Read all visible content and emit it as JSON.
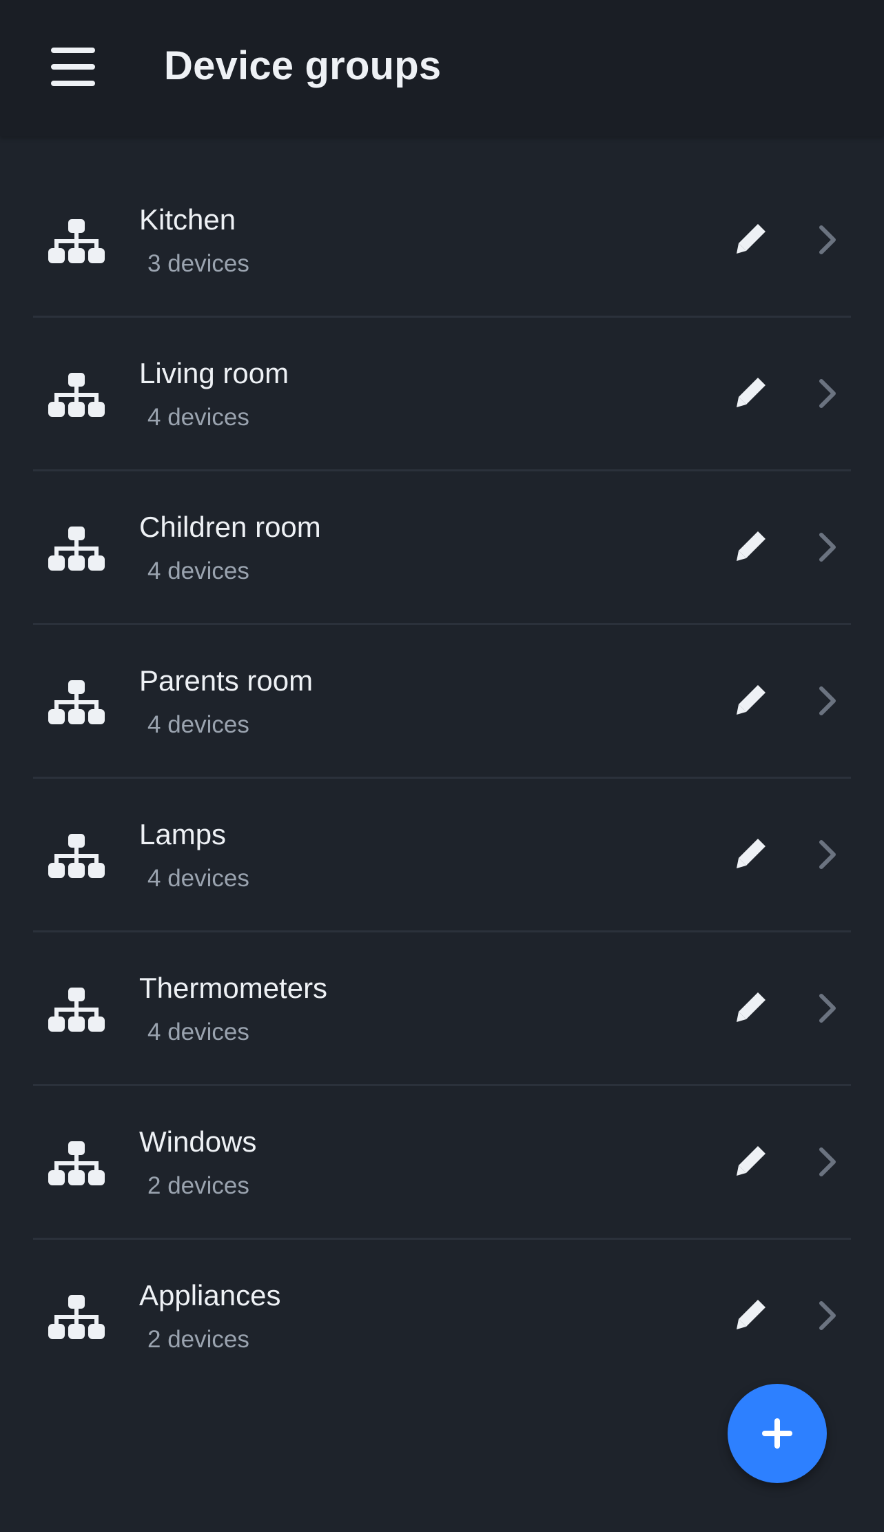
{
  "header": {
    "title": "Device groups",
    "menu_icon": "hamburger-menu-icon"
  },
  "groups": [
    {
      "name": "Kitchen",
      "count": "3 devices"
    },
    {
      "name": "Living room",
      "count": "4 devices"
    },
    {
      "name": "Children room",
      "count": "4 devices"
    },
    {
      "name": "Parents room",
      "count": "4 devices"
    },
    {
      "name": "Lamps",
      "count": "4 devices"
    },
    {
      "name": "Thermometers",
      "count": "4 devices"
    },
    {
      "name": "Windows",
      "count": "2 devices"
    },
    {
      "name": "Appliances",
      "count": "2 devices"
    }
  ],
  "icons": {
    "group": "sitemap-group-icon",
    "edit": "pencil-edit-icon",
    "open": "chevron-right-icon",
    "add": "plus-icon"
  },
  "colors": {
    "background": "#1e232b",
    "header": "#1a1e25",
    "text": "#eef1f5",
    "muted_text": "#9aa3af",
    "divider": "#2b313b",
    "chevron": "#6b7380",
    "accent": "#2d80ff"
  }
}
